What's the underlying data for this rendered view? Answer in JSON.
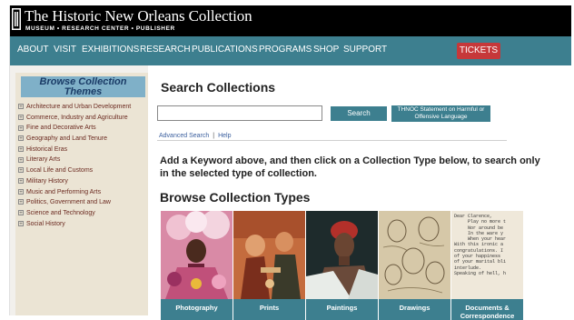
{
  "header": {
    "title": "The Historic New Orleans Collection",
    "subtitle": "MUSEUM • RESEARCH CENTER • PUBLISHER"
  },
  "nav": {
    "items": [
      "ABOUT",
      "VISIT",
      "EXHIBITIONS",
      "RESEARCH",
      "PUBLICATIONS",
      "PROGRAMS",
      "SHOP",
      "SUPPORT"
    ],
    "tickets": "TICKETS"
  },
  "sidebar": {
    "title": "Browse Collection Themes",
    "items": [
      "Architecture and Urban Development",
      "Commerce, Industry and Agriculture",
      "Fine and Decorative Arts",
      "Geography and Land Tenure",
      "Historical Eras",
      "Literary Arts",
      "Local Life and Customs",
      "Military History",
      "Music and Performing Arts",
      "Politics, Government and Law",
      "Science and Technology",
      "Social History"
    ]
  },
  "main": {
    "heading": "Search Collections",
    "search_value": "",
    "search_button": "Search",
    "statement_button": "THNOC Statement on Harmful or Offensive Language",
    "advanced_search": "Advanced Search",
    "link_sep": "|",
    "help": "Help",
    "instructions": "Add a Keyword above, and then click on a Collection Type below, to search only in the selected type of collection.",
    "types_heading": "Browse Collection Types",
    "types": [
      "Photography",
      "Prints",
      "Paintings",
      "Drawings",
      "Documents & Correspondence"
    ]
  },
  "letter_lines": [
    "Dear Clarence,",
    "",
    "     Play no more t",
    "     Nor around be",
    "     In the ware y",
    "     When your hear",
    "",
    "With this ironic a",
    "congratulations. I",
    "of your happiness",
    "of your marital bli",
    "interlude.",
    "",
    "Speaking of hell, h"
  ],
  "colors": {
    "nav": "#3d7f8f",
    "tickets": "#c6383a",
    "sidebar_bg": "#ebe4d4",
    "sidebar_title_bg": "#7fb0c8",
    "sidebar_link": "#6b2a20"
  }
}
